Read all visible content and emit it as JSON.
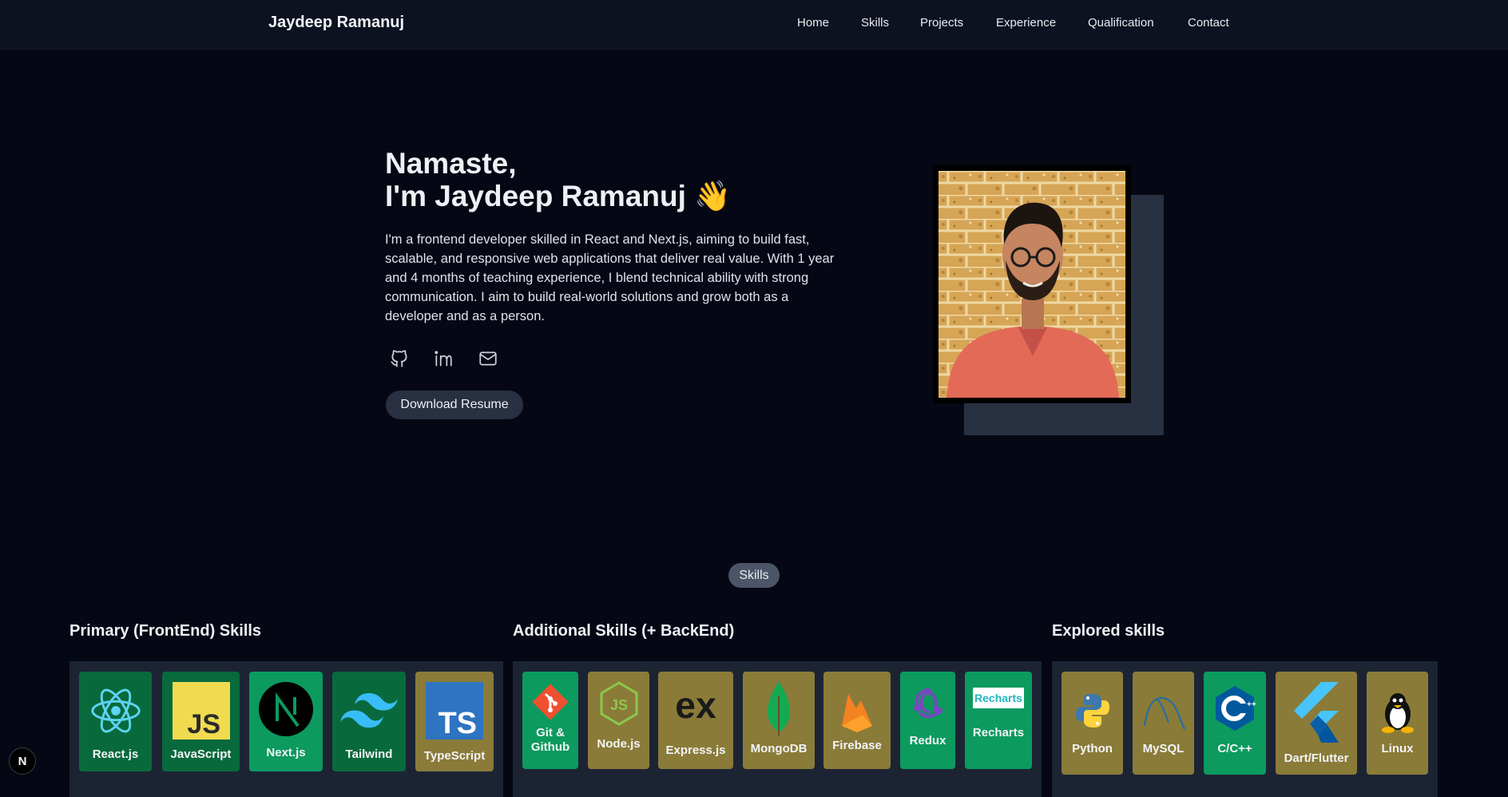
{
  "header": {
    "brand": "Jaydeep Ramanuj",
    "nav": [
      "Home",
      "Skills",
      "Projects",
      "Experience",
      "Qualification",
      "Contact"
    ]
  },
  "hero": {
    "title_line1": "Namaste,",
    "title_line2": "I'm Jaydeep Ramanuj 👋",
    "description": "I'm a frontend developer skilled in React and Next.js, aiming to build fast, scalable, and responsive web applications that deliver real value. With 1 year and 4 months of teaching experience, I blend technical ability with strong communication. I aim to build real-world solutions and grow both as a developer and as a person.",
    "socials": [
      "github-icon",
      "linkedin-icon",
      "mail-icon"
    ],
    "resume_label": "Download Resume"
  },
  "skills": {
    "badge": "Skills",
    "primary": {
      "title": "Primary (FrontEnd) Skills",
      "items": [
        "React.js",
        "JavaScript",
        "Next.js",
        "Tailwind",
        "TypeScript"
      ]
    },
    "additional": {
      "title": "Additional Skills (+ BackEnd)",
      "items": [
        "Git &\nGithub",
        "Node.js",
        "Express.js",
        "MongoDB",
        "Firebase",
        "Redux",
        "Recharts"
      ],
      "logo_text": {
        "express": "ex",
        "recharts": "Recharts"
      }
    },
    "explored": {
      "title": "Explored skills",
      "items": [
        "Python",
        "MySQL",
        "C/C++",
        "Dart/Flutter",
        "Linux"
      ]
    }
  },
  "logo_text": {
    "js": "JS",
    "ts": "TS"
  },
  "corner_badge": "N",
  "colors": {
    "background": "#050814",
    "navbar": "#0d1220",
    "tile_dark_green": "#086a3c",
    "tile_green": "#0c9a5f",
    "tile_olive": "#8a7b39"
  }
}
